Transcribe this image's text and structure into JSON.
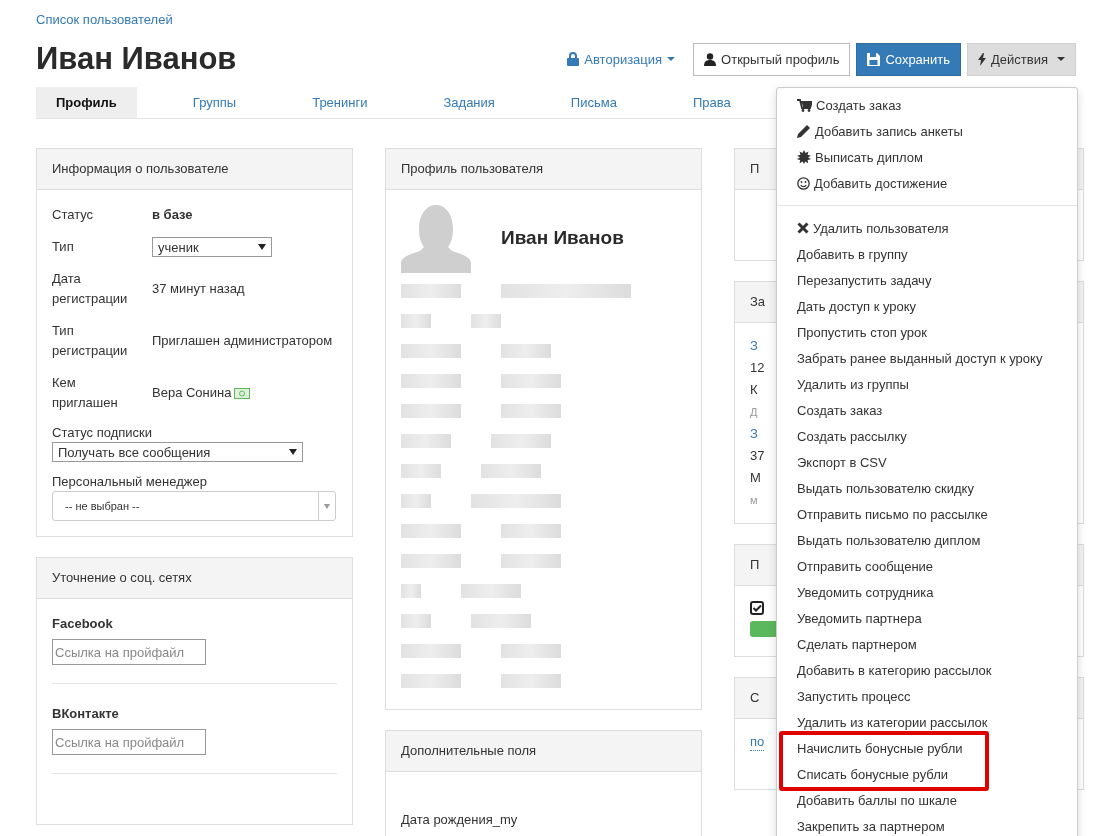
{
  "breadcrumb": "Список пользователей",
  "title": "Иван Иванов",
  "header_actions": {
    "auth": "Авторизация",
    "open_profile": "Открытый профиль",
    "save": "Сохранить",
    "actions": "Действия"
  },
  "tabs": [
    {
      "label": "Профиль",
      "selected": true
    },
    {
      "label": "Группы",
      "selected": false
    },
    {
      "label": "Тренинги",
      "selected": false
    },
    {
      "label": "Задания",
      "selected": false
    },
    {
      "label": "Письма",
      "selected": false
    },
    {
      "label": "Права",
      "selected": false
    }
  ],
  "user_info": {
    "title": "Информация о пользователе",
    "rows": [
      {
        "label": "Статус",
        "kind": "bold",
        "value": "в базе"
      },
      {
        "label": "Тип",
        "kind": "select",
        "value": "ученик"
      },
      {
        "label": "Дата регистрации",
        "kind": "text",
        "value": "37 минут назад"
      },
      {
        "label": "Тип регистрации",
        "kind": "text",
        "value": "Приглашен администратором"
      },
      {
        "label": "Кем приглашен",
        "kind": "money",
        "value": "Вера Сонина"
      }
    ],
    "subscription_label": "Статус подписки",
    "subscription_value": "Получать все сообщения",
    "manager_label": "Персональный менеджер",
    "manager_value": "-- не выбран --"
  },
  "social": {
    "title": "Уточнение о соц. сетях",
    "networks": [
      {
        "name": "Facebook",
        "placeholder": "Ссылка на пройфайл"
      },
      {
        "name": "ВКонтакте",
        "placeholder": "Ссылка на пройфайл"
      }
    ]
  },
  "profile": {
    "title": "Профиль пользователя",
    "name": "Иван Иванов",
    "hidden_fields": [
      {
        "kind": "blurred"
      },
      {
        "kind": "blurred"
      },
      {
        "kind": "blurred"
      },
      {
        "kind": "blurred"
      },
      {
        "kind": "blurred"
      },
      {
        "kind": "blurred"
      },
      {
        "kind": "blurred"
      },
      {
        "kind": "blurred"
      },
      {
        "kind": "blurred"
      },
      {
        "kind": "blurred"
      },
      {
        "kind": "blurred"
      },
      {
        "kind": "blurred"
      },
      {
        "kind": "blurred"
      },
      {
        "kind": "blurred"
      }
    ]
  },
  "extra_fields": {
    "title": "Дополнительные поля",
    "field": "Дата рождения_my"
  },
  "right_column": [
    {
      "title": "П"
    },
    {
      "title": "За",
      "lines": [
        {
          "text": "З",
          "kind": "link"
        },
        {
          "text": "12",
          "kind": "text"
        },
        {
          "text": "К",
          "kind": "text"
        },
        {
          "text": "Д",
          "kind": "muted"
        },
        {
          "text": "З",
          "kind": "link"
        },
        {
          "text": "37",
          "kind": "text"
        },
        {
          "text": "М",
          "kind": "text"
        },
        {
          "text": "м",
          "kind": "muted"
        }
      ]
    },
    {
      "title": "П",
      "lines": [
        {
          "kind": "check"
        }
      ]
    },
    {
      "title": "С",
      "lines": [
        {
          "text": "по",
          "kind": "dotted"
        }
      ]
    }
  ],
  "actions_menu": [
    {
      "kind": "icons",
      "items": [
        {
          "label": "Создать заказ",
          "kind": "icon"
        },
        {
          "label": "Добавить запись анкеты",
          "kind": "icon"
        },
        {
          "label": "Выписать диплом",
          "kind": "icon"
        },
        {
          "label": "Добавить достижение",
          "kind": "icon"
        }
      ]
    },
    {
      "kind": "plain",
      "items": [
        {
          "label": "Удалить пользователя",
          "kind": "icon"
        },
        {
          "label": "Добавить в группу"
        },
        {
          "label": "Перезапустить задачу"
        },
        {
          "label": "Дать доступ к уроку"
        },
        {
          "label": "Пропустить стоп урок"
        },
        {
          "label": "Забрать ранее выданный доступ к уроку"
        },
        {
          "label": "Удалить из группы"
        },
        {
          "label": "Создать заказ"
        },
        {
          "label": "Создать рассылку"
        },
        {
          "label": "Экспорт в CSV"
        },
        {
          "label": "Выдать пользователю скидку"
        },
        {
          "label": "Отправить письмо по рассылке"
        },
        {
          "label": "Выдать пользователю диплом"
        },
        {
          "label": "Отправить сообщение"
        },
        {
          "label": "Уведомить сотрудника"
        },
        {
          "label": "Уведомить партнера"
        },
        {
          "label": "Сделать партнером"
        },
        {
          "label": "Добавить в категорию рассылок"
        },
        {
          "label": "Запустить процесс"
        },
        {
          "label": "Удалить из категории рассылок"
        }
      ]
    },
    {
      "kind": "highlighted",
      "items": [
        {
          "label": "Начислить бонусные рубли"
        },
        {
          "label": "Списать бонусные рубли"
        }
      ]
    },
    {
      "kind": "plain",
      "items": [
        {
          "label": "Добавить баллы по шкале"
        },
        {
          "label": "Закрепить за партнером"
        }
      ]
    }
  ]
}
